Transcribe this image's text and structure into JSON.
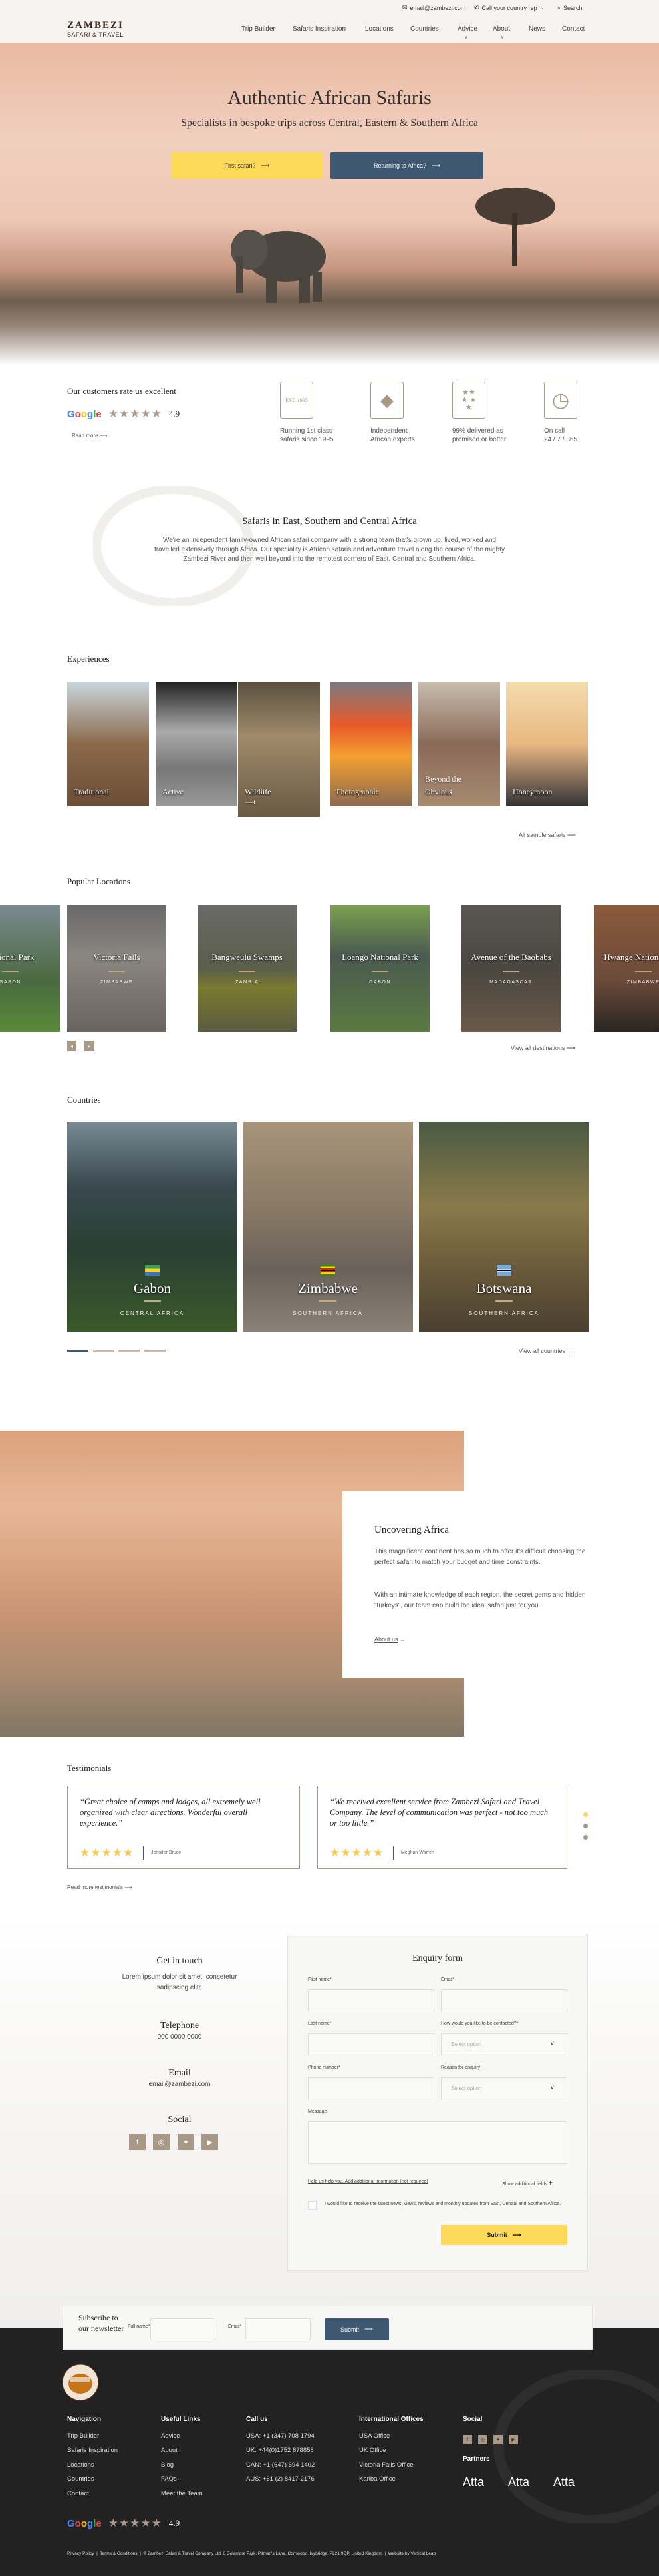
{
  "topbar": {
    "email": "email@zambezi.com",
    "call": "Call your country rep",
    "search": "Search"
  },
  "logo": {
    "line1": "ZAMBEZI",
    "line2": "SAFARI & TRAVEL"
  },
  "nav": [
    "Trip Builder",
    "Safaris Inspiration",
    "Locations",
    "Countries",
    "Advice",
    "About",
    "News",
    "Contact"
  ],
  "hero": {
    "title": "Authentic African Safaris",
    "subtitle": "Specialists in bespoke trips across Central, Eastern & Southern Africa",
    "btn_first": "First safari?",
    "btn_return": "Returning to Africa?"
  },
  "rating": {
    "title": "Our customers rate us excellent",
    "provider": "Google",
    "score": "4.9",
    "stars": 5,
    "read_more": "Read more"
  },
  "features": [
    {
      "icon": "laurel-1995-icon",
      "badge": "EST. 1995",
      "line1": "Running 1st class",
      "line2": "safaris since 1995"
    },
    {
      "icon": "africa-map-icon",
      "line1": "Independent",
      "line2": "African experts"
    },
    {
      "icon": "stars-icon",
      "line1": "99% delivered as",
      "line2": "promised or better"
    },
    {
      "icon": "clock-icon",
      "line1": "On call",
      "line2": "24 / 7 / 365"
    }
  ],
  "intro": {
    "title": "Safaris in East, Southern and Central Africa",
    "text": "We're an independent family-owned African safari  company with a strong team that's grown up, lived, worked and travelled extensively through Africa. Our speciality is African safaris and adventure travel along the course of the mighty Zambezi River and then well beyond into the remotest corners of East, Central and Southern Africa."
  },
  "experiences": {
    "title": "Experiences",
    "items": [
      "Traditional",
      "Active",
      "Wildlife",
      "Photographic",
      "Beyond the Obvious",
      "Honeymoon"
    ],
    "link": "All sample safaris"
  },
  "locations": {
    "title": "Popular Locations",
    "items": [
      {
        "name": "National Park",
        "country": "GABON"
      },
      {
        "name": "Victoria Falls",
        "country": "ZIMBABWE"
      },
      {
        "name": "Bangweulu Swamps",
        "country": "ZAMBIA"
      },
      {
        "name": "Loango National Park",
        "country": "GABON"
      },
      {
        "name": "Avenue of the Baobabs",
        "country": "MADAGASCAR"
      },
      {
        "name": "Hwange National Park",
        "country": "ZIMBABWE"
      }
    ],
    "link": "View all destinations"
  },
  "countries": {
    "title": "Countries",
    "items": [
      {
        "name": "Gabon",
        "region": "CENTRAL AFRICA"
      },
      {
        "name": "Zimbabwe",
        "region": "SOUTHERN AFRICA"
      },
      {
        "name": "Botswana",
        "region": "SOUTHERN AFRICA"
      }
    ],
    "link": "View all countries"
  },
  "uncovering": {
    "title": "Uncovering Africa",
    "p1": "This magnificent continent has so much to offer it's difficult choosing the perfect safari to match your budget and time constraints.",
    "p2": "With an intimate knowledge of each region, the secret gems and hidden \"turkeys\", our team can build the ideal safari just for you.",
    "link": "About us"
  },
  "testimonials": {
    "title": "Testimonials",
    "items": [
      {
        "quote": "“Great choice of camps and lodges, all extremely well organized with clear directions. Wonderful overall experience.”",
        "author": "Jennifer Bruce"
      },
      {
        "quote": "“We received excellent service from Zambezi Safari and Travel Company. The level of communication was perfect - not too much or too little.”",
        "author": "Meghan Warren"
      }
    ],
    "link": "Read more testimonials"
  },
  "contact": {
    "title": "Get in touch",
    "text": "Lorem ipsum dolor sit amet, consetetur sadipscing elitr.",
    "tel_label": "Telephone",
    "tel": "000 0000 0000",
    "email_label": "Email",
    "email": "email@zambezi.com",
    "social_label": "Social"
  },
  "form": {
    "title": "Enquiry form",
    "first_name": "First name*",
    "email": "Email*",
    "last_name": "Last name*",
    "contact_method": "How would you like to be contacted?*",
    "phone": "Phone number*",
    "reason": "Reason for enquiry",
    "select_placeholder": "Select option",
    "message": "Message",
    "help_link": "Help us help you. Add additional information (not required)",
    "show_more": "Show additional fields",
    "consent": "I would like to receive the latest news, views, reviews and monthly updates from East, Central and Southern Africa.",
    "submit": "Submit"
  },
  "newsletter": {
    "title": "Subscribe to our newsletter",
    "full_name": "Full name*",
    "email": "Email*",
    "submit": "Submit"
  },
  "footer": {
    "nav_title": "Navigation",
    "nav": [
      "Trip Builder",
      "Safaris Inspiration",
      "Locations",
      "Countries",
      "Contact"
    ],
    "useful_title": "Useful Links",
    "useful": [
      "Advice",
      "About",
      "Blog",
      "FAQs",
      "Meet the Team"
    ],
    "call_title": "Call us",
    "call": [
      "USA: +1 (347) 708 1794",
      "UK: +44(0)1752 878858",
      "CAN: +1 (647) 694 1402",
      "AUS: +61 (2) 8417 2176"
    ],
    "offices_title": "International Offices",
    "offices": [
      "USA Office",
      "UK Office",
      "Victoria Falls Office",
      "Kariba Office"
    ],
    "social_title": "Social",
    "partners_title": "Partners",
    "partner": "Atta",
    "rating_provider": "Google",
    "rating_score": "4.9",
    "legal": "Privacy Policy  |  Terms & Conditions  |  © Zambezi Safari & Travel Company Ltd, 6 Delamore Park, Pitman's Lane, Cornwood, Ivybridge, PL21 9QP, United Kingdom  |  Website by Vertical Leap"
  },
  "colors": {
    "accent_yellow": "#fdd95a",
    "accent_navy": "#3f5872",
    "taupe": "#a89886",
    "footer_bg": "#232223"
  }
}
